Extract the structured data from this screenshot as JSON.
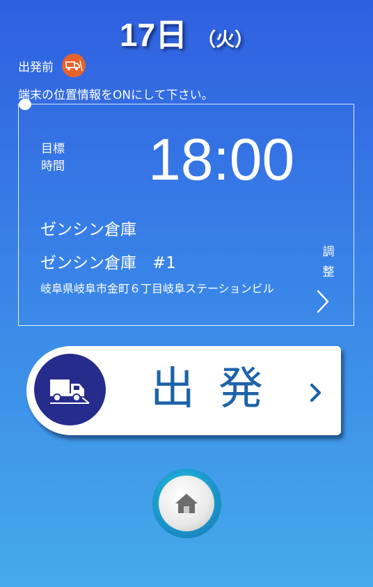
{
  "header": {
    "day": "17日",
    "weekday": "（火）"
  },
  "status": {
    "label": "出発前",
    "icon": "truck-icon",
    "icon_color": "#e8622c"
  },
  "notice": "端末の位置情報をONにして下さい。",
  "target": {
    "label": "目標時間",
    "time": "18:00"
  },
  "destination": {
    "name": "ゼンシン倉庫",
    "sub": "ゼンシン倉庫　#1",
    "address": "岐阜県岐阜市金町６丁目岐阜ステーションビル"
  },
  "adjust": {
    "label": "調整",
    "icon": "chevron-right-icon"
  },
  "depart_button": {
    "label": "出発",
    "icon": "truck-icon",
    "accent": "#1e63a8",
    "circle_color": "#262c8c"
  },
  "home_button": {
    "icon": "home-icon"
  }
}
